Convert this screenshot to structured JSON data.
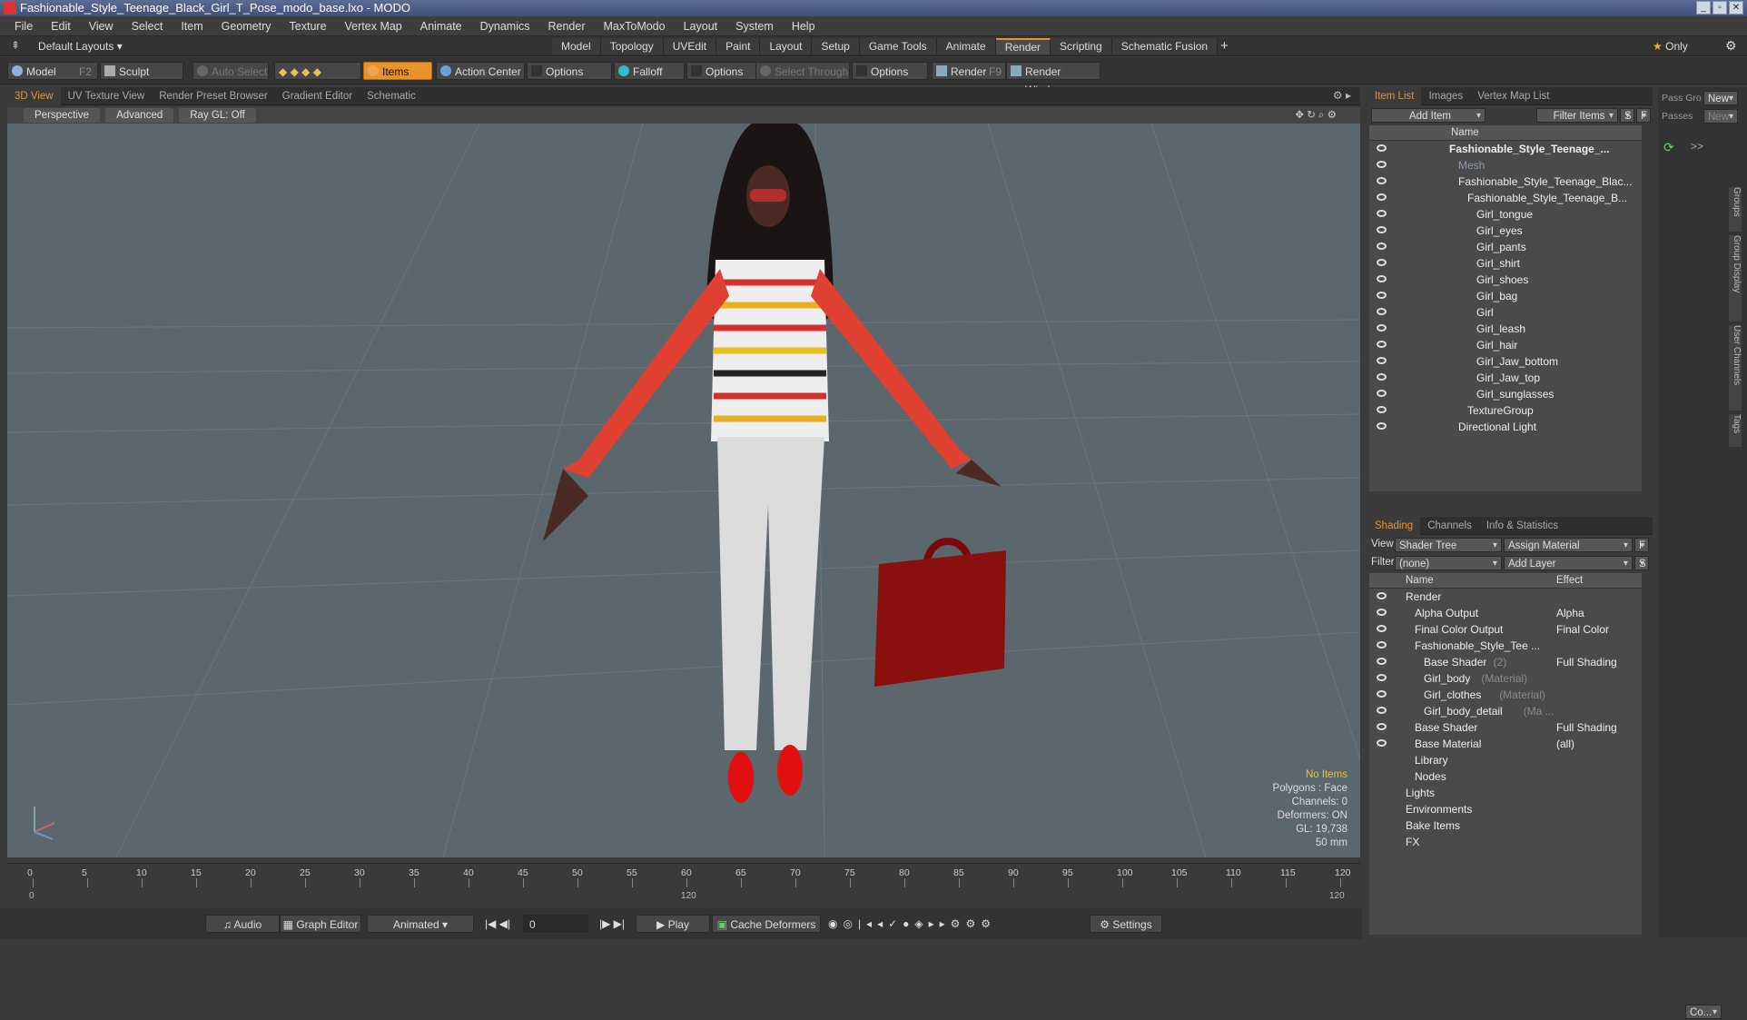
{
  "window": {
    "title": "Fashionable_Style_Teenage_Black_Girl_T_Pose_modo_base.lxo - MODO"
  },
  "menu": [
    "File",
    "Edit",
    "View",
    "Select",
    "Item",
    "Geometry",
    "Texture",
    "Vertex Map",
    "Animate",
    "Dynamics",
    "Render",
    "MaxToModo",
    "Layout",
    "System",
    "Help"
  ],
  "layout": {
    "selector": "Default Layouts",
    "only": "Only",
    "tabs": [
      "Model",
      "Topology",
      "UVEdit",
      "Paint",
      "Layout",
      "Setup",
      "Game Tools",
      "Animate",
      "Render",
      "Scripting",
      "Schematic Fusion"
    ],
    "active_tab": "Render"
  },
  "toolbar": {
    "model": "Model",
    "model_key": "F2",
    "sculpt": "Sculpt",
    "auto_select": "Auto Select",
    "items": "Items",
    "action_center": "Action Center",
    "options1": "Options",
    "falloff": "Falloff",
    "options2": "Options",
    "select_through": "Select Through",
    "options3": "Options",
    "render": "Render",
    "render_key": "F9",
    "render_window": "Render Window"
  },
  "viewport_tabs": [
    "3D View",
    "UV Texture View",
    "Render Preset Browser",
    "Gradient Editor",
    "Schematic"
  ],
  "viewport_bar": {
    "perspective": "Perspective",
    "advanced": "Advanced",
    "raygl": "Ray GL: Off"
  },
  "stats": {
    "no_items": "No Items",
    "polygons": "Polygons : Face",
    "channels": "Channels: 0",
    "deformers": "Deformers: ON",
    "gl": "GL: 19,738",
    "mm": "50 mm"
  },
  "timeline": {
    "ticks": [
      "0",
      "5",
      "10",
      "15",
      "20",
      "25",
      "30",
      "35",
      "40",
      "45",
      "50",
      "55",
      "60",
      "65",
      "70",
      "75",
      "80",
      "85",
      "90",
      "95",
      "100",
      "105",
      "110",
      "115",
      "120"
    ],
    "start": "0",
    "mid": "120",
    "end": "120"
  },
  "bottom": {
    "audio": "Audio",
    "graph_editor": "Graph Editor",
    "animated": "Animated",
    "frame": "0",
    "play": "Play",
    "cache": "Cache Deformers",
    "settings": "Settings"
  },
  "item_panel": {
    "tabs": [
      "Item List",
      "Images",
      "Vertex Map List"
    ],
    "add_item": "Add Item",
    "filter_items": "Filter Items",
    "s": "S",
    "f": "F",
    "name_col": "Name",
    "items": [
      {
        "label": "Fashionable_Style_Teenage_...",
        "indent": 0,
        "bold": true
      },
      {
        "label": "Mesh",
        "indent": 1,
        "dim": true
      },
      {
        "label": "Fashionable_Style_Teenage_Blac...",
        "indent": 1
      },
      {
        "label": "Fashionable_Style_Teenage_B...",
        "indent": 2
      },
      {
        "label": "Girl_tongue",
        "indent": 3
      },
      {
        "label": "Girl_eyes",
        "indent": 3
      },
      {
        "label": "Girl_pants",
        "indent": 3
      },
      {
        "label": "Girl_shirt",
        "indent": 3
      },
      {
        "label": "Girl_shoes",
        "indent": 3
      },
      {
        "label": "Girl_bag",
        "indent": 3
      },
      {
        "label": "Girl",
        "indent": 3
      },
      {
        "label": "Girl_leash",
        "indent": 3
      },
      {
        "label": "Girl_hair",
        "indent": 3
      },
      {
        "label": "Girl_Jaw_bottom",
        "indent": 3
      },
      {
        "label": "Girl_Jaw_top",
        "indent": 3
      },
      {
        "label": "Girl_sunglasses",
        "indent": 3
      },
      {
        "label": "TextureGroup",
        "indent": 2
      },
      {
        "label": "Directional Light",
        "indent": 1
      }
    ]
  },
  "shading_panel": {
    "tabs": [
      "Shading",
      "Channels",
      "Info & Statistics"
    ],
    "view_label": "View",
    "view_value": "Shader Tree",
    "assign": "Assign Material",
    "f": "F",
    "filter_label": "Filter",
    "filter_value": "(none)",
    "add_layer": "Add Layer",
    "s": "S",
    "name_col": "Name",
    "effect_col": "Effect",
    "rows": [
      {
        "label": "Render",
        "effect": "",
        "indent": 0,
        "eye": true
      },
      {
        "label": "Alpha Output",
        "effect": "Alpha",
        "indent": 1,
        "eye": true
      },
      {
        "label": "Final Color Output",
        "effect": "Final Color",
        "indent": 1,
        "eye": true
      },
      {
        "label": "Fashionable_Style_Tee ...",
        "effect": "",
        "indent": 1,
        "eye": true
      },
      {
        "label": "Base Shader",
        "note": "(2)",
        "effect": "Full Shading",
        "indent": 2,
        "eye": true
      },
      {
        "label": "Girl_body",
        "note": "(Material)",
        "effect": "",
        "indent": 2,
        "eye": true
      },
      {
        "label": "Girl_clothes",
        "note": "(Material)",
        "effect": "",
        "indent": 2,
        "eye": true
      },
      {
        "label": "Girl_body_detail",
        "note": "(Ma ...",
        "effect": "",
        "indent": 2,
        "eye": true
      },
      {
        "label": "Base Shader",
        "effect": "Full Shading",
        "indent": 1,
        "eye": true
      },
      {
        "label": "Base Material",
        "effect": "(all)",
        "indent": 1,
        "eye": true
      },
      {
        "label": "Library",
        "effect": "",
        "indent": 1,
        "eye": false
      },
      {
        "label": "Nodes",
        "effect": "",
        "indent": 1,
        "eye": false
      },
      {
        "label": "Lights",
        "effect": "",
        "indent": 0,
        "eye": false
      },
      {
        "label": "Environments",
        "effect": "",
        "indent": 0,
        "eye": false
      },
      {
        "label": "Bake Items",
        "effect": "",
        "indent": 0,
        "eye": false
      },
      {
        "label": "FX",
        "effect": "",
        "indent": 0,
        "eye": false
      }
    ]
  },
  "far_right": {
    "pass_gro": "Pass Gro",
    "new1": "New",
    "passes": "Passes",
    "new2": "New",
    "vtabs": [
      "Groups",
      "Group Display",
      "User Channels",
      "Tags"
    ],
    "co": "Co..."
  }
}
